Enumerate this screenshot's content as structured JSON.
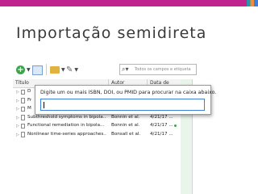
{
  "colors": {
    "accent": "#c0238f",
    "tile_teal": "#2a96a5",
    "tile_orange": "#f08c3c",
    "tile_blue": "#3c7fd6"
  },
  "slide": {
    "title": "Importação semidireta"
  },
  "toolbar": {
    "buttons": [
      {
        "icon": "new-item-icon",
        "glyph": "+"
      },
      {
        "icon": "add-by-identifier-icon"
      },
      {
        "icon": "new-collection-icon"
      },
      {
        "icon": "attachment-icon",
        "glyph": "✎"
      }
    ],
    "search": {
      "placeholder": "Todos os campos e etiqueta"
    }
  },
  "list": {
    "columns": {
      "title": "Título",
      "author": "Autor",
      "date": "Data de"
    },
    "rows": [
      {
        "title": "D",
        "author": "",
        "date": ""
      },
      {
        "title": "Fr",
        "author": "",
        "date": ""
      },
      {
        "title": "M",
        "author": "",
        "date": ""
      },
      {
        "title": "Subthreshold symptoms in bipola...",
        "author": "Bonnin et al.",
        "date": "4/21/17 ..."
      },
      {
        "title": "Functional remediation in bipola...",
        "author": "Bonnin et al.",
        "date": "4/21/17 ..."
      },
      {
        "title": "Nonlinear time-series approaches...",
        "author": "Bonsall et al.",
        "date": "4/21/17 ..."
      }
    ]
  },
  "popup": {
    "prompt": "Digite um ou mais ISBN, DOI, ou PMID para procurar na caixa abaixo.",
    "value": ""
  }
}
